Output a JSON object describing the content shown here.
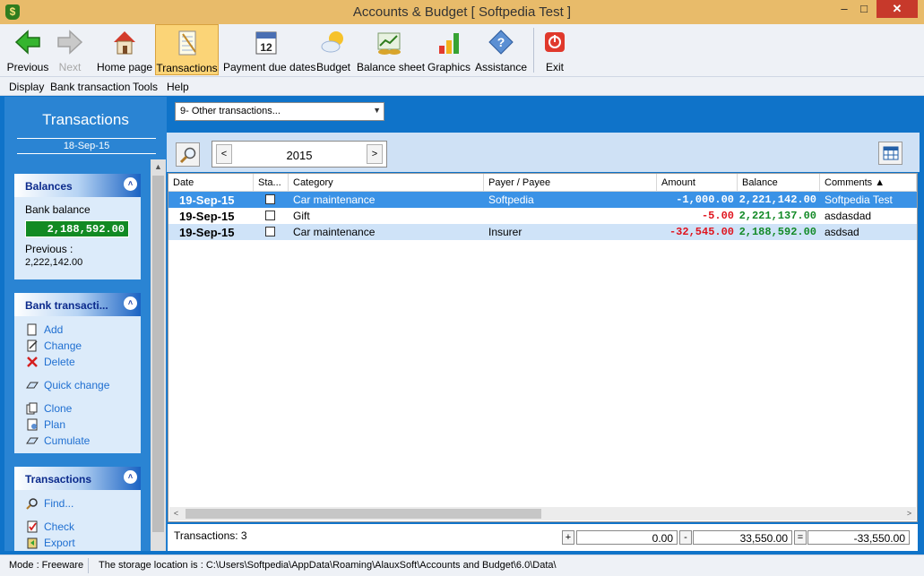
{
  "window": {
    "title": "Accounts & Budget [ Softpedia Test ]",
    "app_icon_glyph": "$",
    "minimize_glyph": "–",
    "maximize_glyph": "□",
    "close_glyph": "✕"
  },
  "toolbar": {
    "items": [
      {
        "label": "Previous",
        "icon": "green-left-arrow-icon",
        "enabled": true
      },
      {
        "label": "Next",
        "icon": "gray-right-arrow-icon",
        "enabled": false
      },
      {
        "label": "Home page",
        "icon": "house-icon",
        "enabled": true
      },
      {
        "label": "Transactions",
        "icon": "notepad-icon",
        "enabled": true,
        "active": true
      },
      {
        "label": "Payment due dates",
        "icon": "calendar-icon",
        "enabled": true
      },
      {
        "label": "Budget",
        "icon": "sun-cloud-icon",
        "enabled": true
      },
      {
        "label": "Balance sheet",
        "icon": "money-chart-icon",
        "enabled": true
      },
      {
        "label": "Graphics",
        "icon": "bar-chart-icon",
        "enabled": true
      },
      {
        "label": "Assistance",
        "icon": "question-diamond-icon",
        "enabled": true
      },
      {
        "label": "Exit",
        "icon": "power-icon",
        "enabled": true
      }
    ],
    "calendar_day": "12"
  },
  "menu": [
    "Display",
    "Bank transaction",
    "Tools",
    "Help"
  ],
  "left_panel": {
    "title": "Transactions",
    "date": "18-Sep-15",
    "balances": {
      "header": "Balances",
      "bank_balance_label": "Bank balance",
      "bank_balance_value": "2,188,592.00",
      "previous_label": "Previous :",
      "previous_value": "2,222,142.00"
    },
    "bank_transactions": {
      "header": "Bank transacti...",
      "actions": [
        "Add",
        "Change",
        "Delete",
        "Quick change",
        "Clone",
        "Plan",
        "Cumulate"
      ]
    },
    "transactions": {
      "header": "Transactions",
      "actions": [
        "Find...",
        "Check",
        "Export"
      ]
    },
    "collapse_glyph": "˄"
  },
  "filter": {
    "selected": "9- Other transactions...",
    "dropdown_glyph": "▼"
  },
  "year_nav": {
    "value": "2015",
    "prev_glyph": "<",
    "next_glyph": ">",
    "search_glyph": "⌕",
    "calendar_glyph": "▦"
  },
  "grid": {
    "columns": [
      "Date",
      "Sta...",
      "Category",
      "Payer / Payee",
      "Amount",
      "Balance",
      "Comments ▲"
    ],
    "rows": [
      {
        "date": "19-Sep-15",
        "category": "Car maintenance",
        "payee": "Softpedia",
        "amount": "-1,000.00",
        "balance": "2,221,142.00",
        "comments": "Softpedia Test",
        "selected": true
      },
      {
        "date": "19-Sep-15",
        "category": "Gift",
        "payee": "",
        "amount": "-5.00",
        "balance": "2,221,137.00",
        "comments": "asdasdad",
        "selected": false
      },
      {
        "date": "19-Sep-15",
        "category": "Car maintenance",
        "payee": "Insurer",
        "amount": "-32,545.00",
        "balance": "2,188,592.00",
        "comments": "asdsad",
        "selected": false
      }
    ],
    "scroll_left_glyph": "<",
    "scroll_right_glyph": ">"
  },
  "totals": {
    "count_label": "Transactions: 3",
    "plus_sign": "+",
    "plus_value": "0.00",
    "minus_sign": "-",
    "minus_value": "33,550.00",
    "equals_sign": "=",
    "equals_value": "-33,550.00"
  },
  "status": {
    "mode": "Mode : Freeware",
    "storage": "The storage location is : C:\\Users\\Softpedia\\AppData\\Roaming\\AlauxSoft\\Accounts and Budget\\6.0\\Data\\"
  },
  "colors": {
    "accent_blue": "#0f73c9",
    "active_tab": "#fbd477",
    "negative": "#e0141e",
    "positive": "#138a27",
    "balance_box": "#128a23"
  }
}
